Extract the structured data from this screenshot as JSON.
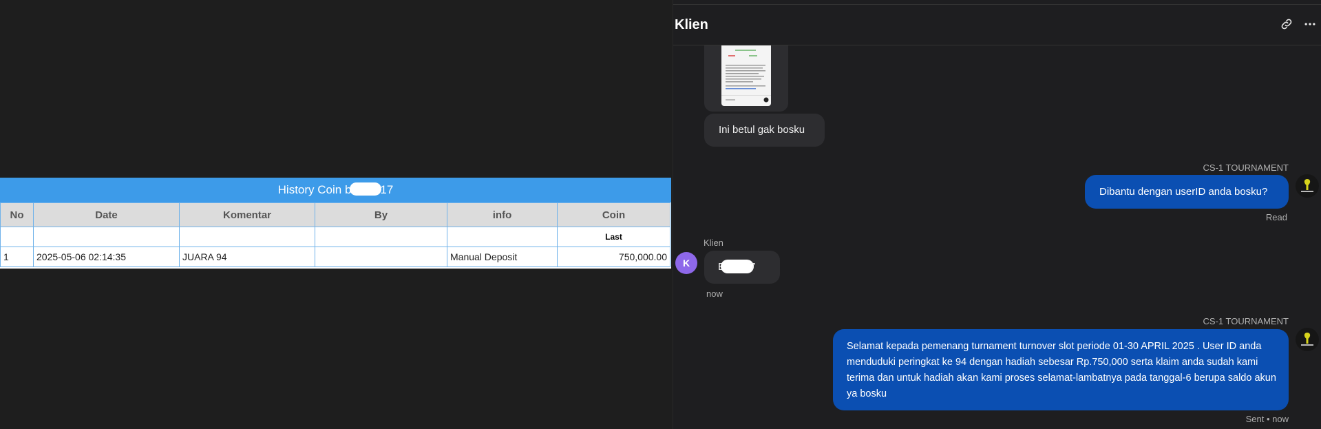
{
  "history": {
    "title_prefix": "History Coin b",
    "title_suffix": "17",
    "columns": [
      "No",
      "Date",
      "Komentar",
      "By",
      "info",
      "Coin"
    ],
    "subheader_last": "Last",
    "rows": [
      {
        "no": "1",
        "date": "2025-05-06 02:14:35",
        "komentar": "JUARA 94",
        "by": "",
        "info": "Manual Deposit",
        "coin": "750,000.00"
      }
    ]
  },
  "chat": {
    "contact_name": "Klien",
    "icons": {
      "link": "link-icon",
      "more": "more-icon"
    },
    "messages": {
      "client_text_1": "Ini betul gak bosku",
      "agent_name_1": "CS-1 TOURNAMENT",
      "agent_msg_1": "Dibantu dengan userID anda bosku?",
      "agent_status_1": "Read",
      "client_name": "Klien",
      "client_avatar_letter": "K",
      "client_text_2_prefix": "B",
      "client_text_2_suffix": "7",
      "client_time_2": "now",
      "agent_name_2": "CS-1 TOURNAMENT",
      "agent_msg_2": "Selamat kepada pemenang turnament turnover slot periode 01-30 APRIL 2025 . User ID anda menduduki peringkat ke 94 dengan hadiah sebesar Rp.750,000 serta klaim anda sudah kami terima dan untuk hadiah akan kami proses selamat-lambatnya pada tanggal-6 berupa saldo akun ya bosku",
      "agent_status_2": "Sent • now"
    }
  },
  "colors": {
    "background": "#1e1e1e",
    "table_header_blue": "#3d9be9",
    "agent_bubble": "#0b4fb2",
    "client_bubble": "#2d2d30",
    "client_avatar": "#8e68ea",
    "coin_green": "#2c8a2c"
  }
}
